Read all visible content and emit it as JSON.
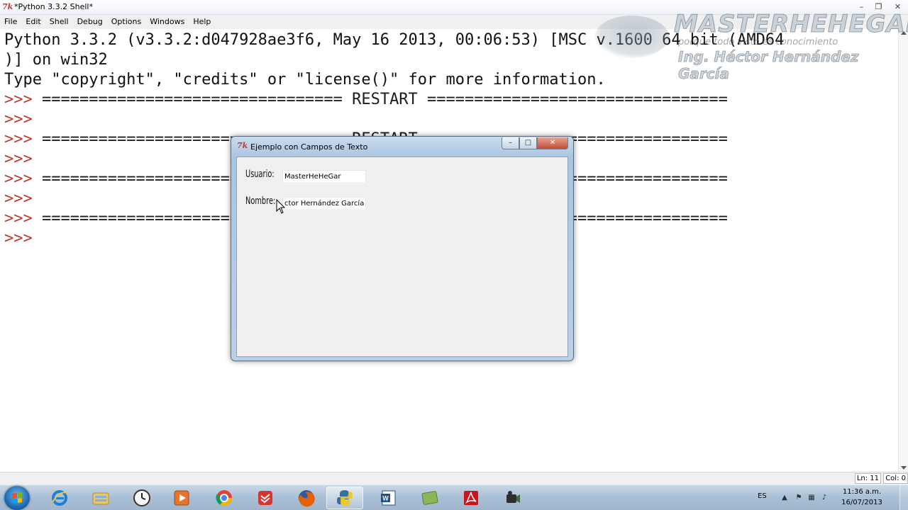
{
  "window": {
    "title": "*Python 3.3.2 Shell*",
    "logo": "7k"
  },
  "menu": [
    "File",
    "Edit",
    "Shell",
    "Debug",
    "Options",
    "Windows",
    "Help"
  ],
  "shell": {
    "banner_1": "Python 3.3.2 (v3.3.2:d047928ae3f6, May 16 2013, 00:06:53) [MSC v.1600 64 bit (AMD64",
    "banner_2": ")] on win32",
    "banner_3": "Type \"copyright\", \"credits\" or \"license()\" for more information.",
    "prompt": ">>>",
    "restart_line": "================================ RESTART ================================",
    "restart_full": " ================================ RESTART ================================",
    "separator": " ======================================================================================="
  },
  "statusbar": {
    "line": "Ln: 11",
    "col": "Col: 0"
  },
  "watermark": {
    "brand": "MASTERHEHEGAR",
    "slogan": "porque todo visto es conocimiento",
    "author": "Ing. Héctor Hernández García"
  },
  "dialog": {
    "icon": "7k",
    "title": "Ejemplo con Campos de Texto",
    "usuario_label": "Usuario:",
    "usuario_value": "MasterHeHeGar",
    "nombre_label": "Nombre:",
    "nombre_value": "ctor Hernández García"
  },
  "taskbar": {
    "apps": [
      {
        "name": "internet-explorer",
        "active": false
      },
      {
        "name": "windows-explorer",
        "active": false
      },
      {
        "name": "clock-app",
        "active": false
      },
      {
        "name": "media-player",
        "active": false
      },
      {
        "name": "chrome",
        "active": false
      },
      {
        "name": "todoist",
        "active": false
      },
      {
        "name": "firefox",
        "active": false
      },
      {
        "name": "python",
        "active": true
      },
      {
        "name": "word",
        "active": false
      },
      {
        "name": "green-app",
        "active": false
      },
      {
        "name": "adobe-reader",
        "active": false
      },
      {
        "name": "camtasia",
        "active": false
      }
    ],
    "tray_lang": "ES",
    "time": "11:36 a.m.",
    "date": "16/07/2013"
  },
  "colors": {
    "prompt": "#c0392b",
    "taskbar": "#a9bfd5",
    "dialog_frame": "#aac5e0"
  }
}
